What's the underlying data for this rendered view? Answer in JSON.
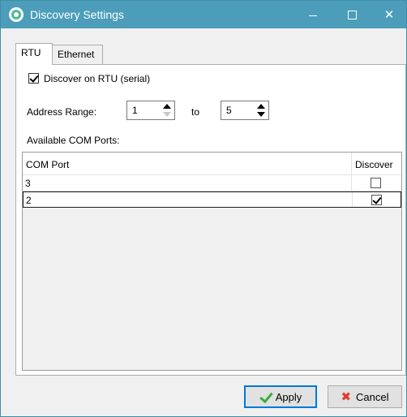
{
  "window": {
    "title": "Discovery Settings",
    "icon": "app-logo-icon",
    "controls": {
      "minimize": "minimize-icon",
      "maximize": "maximize-icon",
      "close": "✕"
    }
  },
  "tabs": [
    {
      "label": "RTU",
      "selected": true
    },
    {
      "label": "Ethernet",
      "selected": false
    }
  ],
  "rtu": {
    "discover_checkbox_label": "Discover on RTU (serial)",
    "discover_checked": true,
    "address_range_label": "Address Range:",
    "address_from": "1",
    "to_label": "to",
    "address_to": "5",
    "available_ports_label": "Available COM Ports:"
  },
  "grid": {
    "columns": [
      "COM Port",
      "Discover"
    ],
    "rows": [
      {
        "port": "3",
        "discover": false
      },
      {
        "port": "2",
        "discover": true
      }
    ]
  },
  "buttons": {
    "apply_label": "Apply",
    "cancel_label": "Cancel",
    "cancel_icon_glyph": "✖"
  },
  "colors": {
    "titlebar": "#4b9dba",
    "apply_icon": "#3cab3c",
    "cancel_icon": "#e23b2e"
  }
}
